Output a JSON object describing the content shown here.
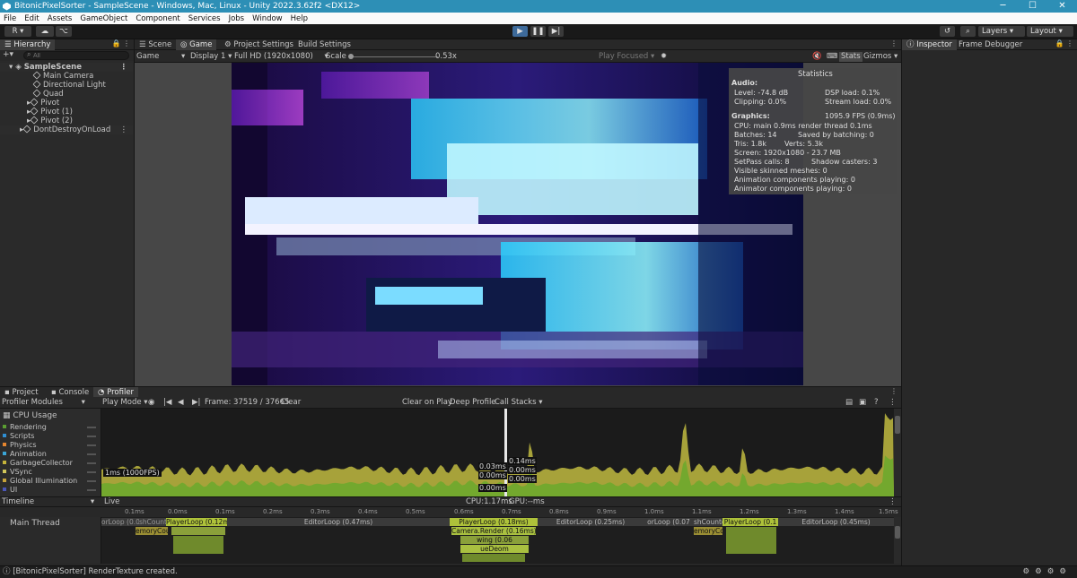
{
  "window": {
    "title": "BitonicPixelSorter - SampleScene - Windows, Mac, Linux - Unity 2022.3.62f2 <DX12>",
    "minimize": "─",
    "maximize": "☐",
    "close": "✕"
  },
  "menu": [
    "File",
    "Edit",
    "Assets",
    "GameObject",
    "Component",
    "Services",
    "Jobs",
    "Window",
    "Help"
  ],
  "toolbar": {
    "account": "R",
    "layers": "Layers",
    "layout": "Layout"
  },
  "hierarchy": {
    "tab": "Hierarchy",
    "search_placeholder": "All",
    "items": [
      {
        "label": "SampleScene"
      },
      {
        "label": "Main Camera"
      },
      {
        "label": "Directional Light"
      },
      {
        "label": "Quad"
      },
      {
        "label": "Pivot"
      },
      {
        "label": "Pivot (1)"
      },
      {
        "label": "Pivot (2)"
      },
      {
        "label": "DontDestroyOnLoad"
      }
    ]
  },
  "scene_tabs": [
    "Scene",
    "Game",
    "Project Settings",
    "Build Settings"
  ],
  "game_toolbar": {
    "mode": "Game",
    "display": "Display 1",
    "resolution": "Full HD (1920x1080)",
    "scale_label": "Scale",
    "scale_value": "0.53x",
    "play_focused": "Play Focused",
    "stats": "Stats",
    "gizmos": "Gizmos"
  },
  "statistics": {
    "title": "Statistics",
    "audio_header": "Audio:",
    "level": "Level: -74.8 dB",
    "dsp": "DSP load: 0.1%",
    "clipping": "Clipping: 0.0%",
    "stream": "Stream load: 0.0%",
    "graphics_header": "Graphics:",
    "fps": "1095.9 FPS (0.9ms)",
    "cpu": "CPU: main 0.9ms  render thread 0.1ms",
    "batches": "Batches: 14",
    "saved": "Saved by batching: 0",
    "tris": "Tris: 1.8k",
    "verts": "Verts: 5.3k",
    "screen": "Screen: 1920x1080 - 23.7 MB",
    "setpass": "SetPass calls: 8",
    "shadow": "Shadow casters: 3",
    "skinned": "Visible skinned meshes: 0",
    "anim": "Animation components playing: 0",
    "animator": "Animator components playing: 0"
  },
  "inspector": {
    "tabs": [
      "Inspector",
      "Frame Debugger"
    ]
  },
  "bottom_tabs": [
    "Project",
    "Console",
    "Profiler"
  ],
  "profiler": {
    "modules_label": "Profiler Modules",
    "play_mode": "Play Mode",
    "frame": "Frame: 37519 / 37665",
    "clear": "Clear",
    "clear_on_play": "Clear on Play",
    "deep_profile": "Deep Profile",
    "call_stacks": "Call Stacks",
    "cpu_usage": "CPU Usage",
    "modules": [
      {
        "name": "Rendering",
        "color": "#5b9e32"
      },
      {
        "name": "Scripts",
        "color": "#2f8fd3"
      },
      {
        "name": "Physics",
        "color": "#e5862f"
      },
      {
        "name": "Animation",
        "color": "#3aa5d6"
      },
      {
        "name": "GarbageCollector",
        "color": "#c4b33a"
      },
      {
        "name": "VSync",
        "color": "#d1c65a"
      },
      {
        "name": "Global Illumination",
        "color": "#c7a33a"
      },
      {
        "name": "UI",
        "color": "#4a56b9"
      }
    ],
    "fps_marker": "1ms (1000FPS)",
    "sel_labels": [
      "0.03ms",
      "0.00ms",
      "0.00ms",
      "0.14ms",
      "0.00ms",
      "0.00ms"
    ],
    "timeline_label": "Timeline",
    "live": "Live",
    "cpu_time": "CPU:1.17ms",
    "gpu_time": "GPU:--ms",
    "ruler": [
      "0.1ms",
      "0.0ms",
      "0.1ms",
      "0.2ms",
      "0.3ms",
      "0.4ms",
      "0.5ms",
      "0.6ms",
      "0.7ms",
      "0.8ms",
      "0.9ms",
      "1.0ms",
      "1.1ms",
      "1.2ms",
      "1.3ms",
      "1.4ms",
      "1.5ms"
    ],
    "thread": "Main Thread",
    "blocks": [
      "orLoop (0.0",
      "shCounter",
      "PlayerLoop (0.12ms)",
      "EditorLoop (0.47ms)",
      "PlayerLoop (0.18ms)",
      "EditorLoop (0.25ms)",
      "orLoop (0.07",
      "shCounter",
      "PlayerLoop (0.1",
      "EditorLoop (0.45ms)",
      "emoryCou",
      "Camera.Render (0.16ms)",
      "wing (0.06",
      "ueDeom",
      "emoryCou"
    ]
  },
  "status": "[BitonicPixelSorter] RenderTexture created."
}
